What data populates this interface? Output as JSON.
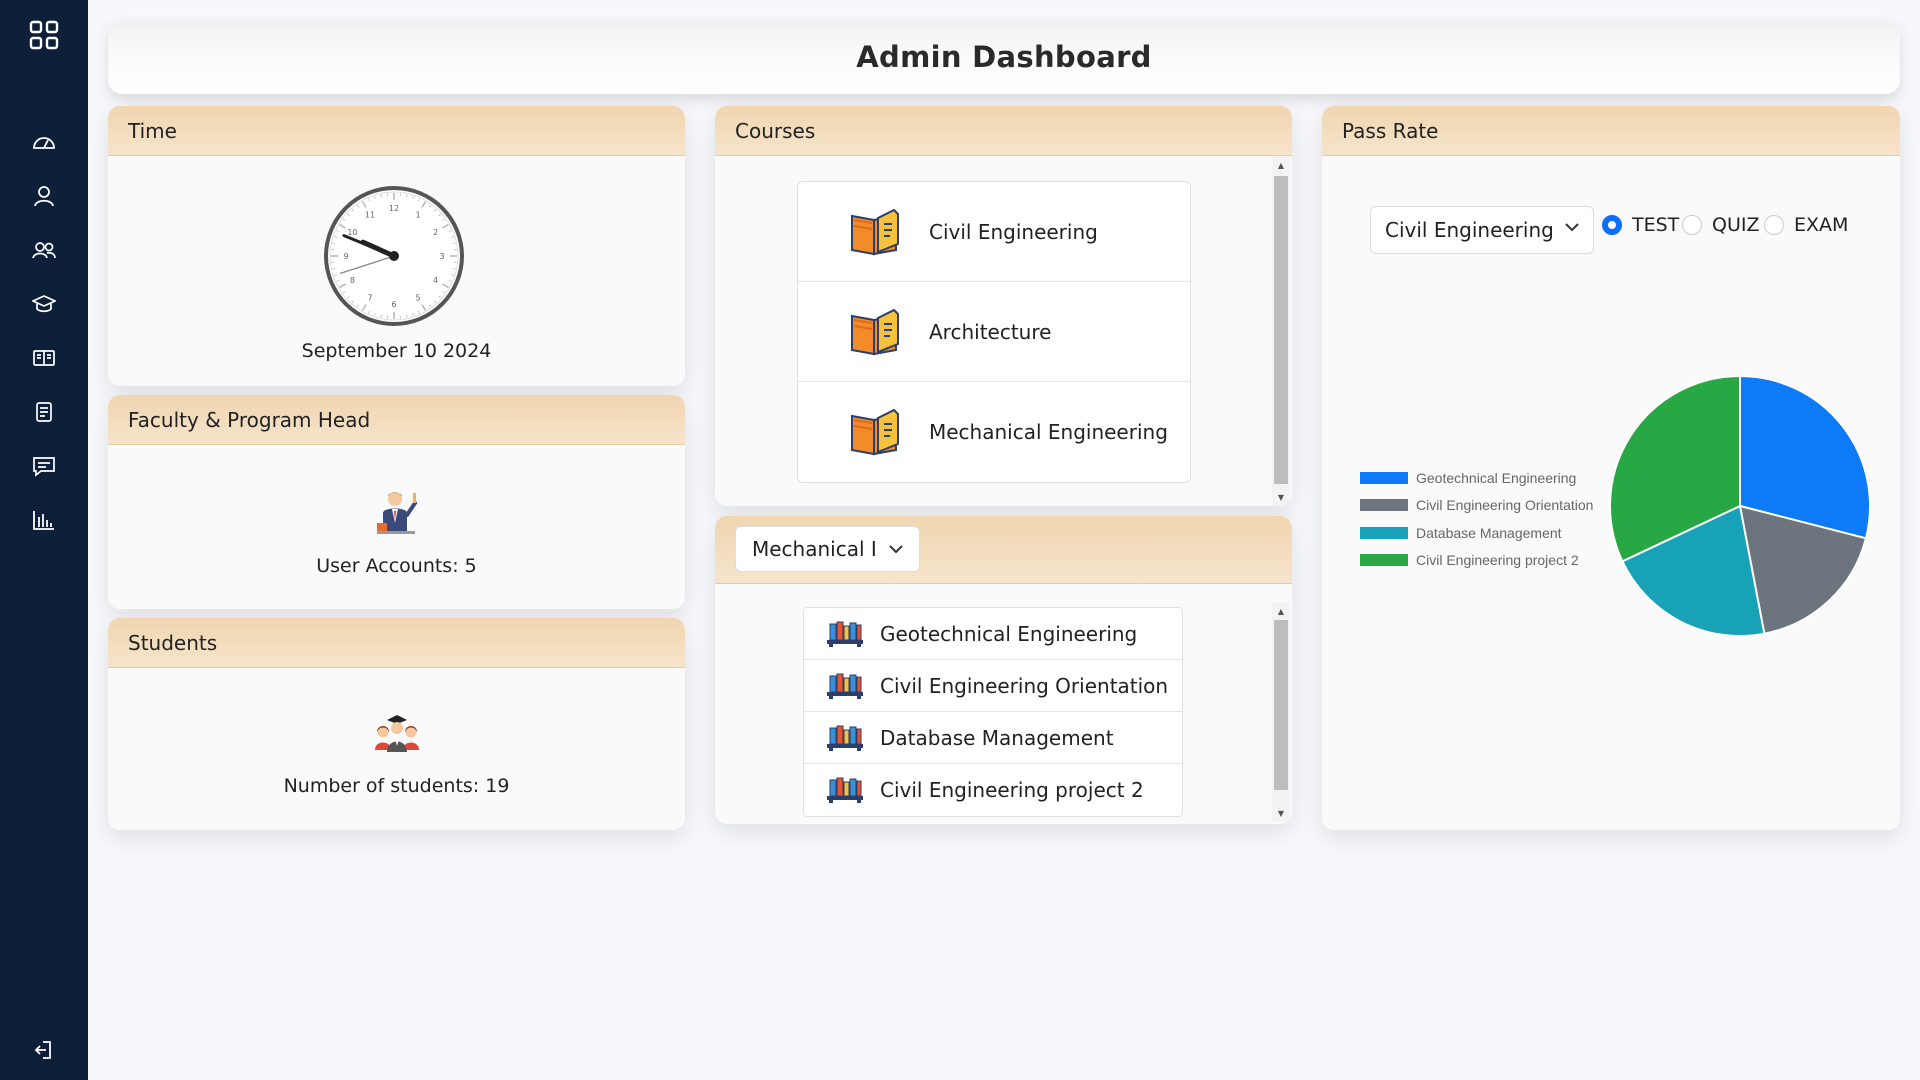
{
  "header": {
    "title": "Admin Dashboard"
  },
  "sidebar": {
    "items": [
      {
        "name": "apps-grid-icon"
      },
      {
        "name": "dashboard-gauge-icon"
      },
      {
        "name": "user-icon"
      },
      {
        "name": "users-icon"
      },
      {
        "name": "graduation-cap-icon"
      },
      {
        "name": "book-open-icon"
      },
      {
        "name": "document-icon"
      },
      {
        "name": "chat-icon"
      },
      {
        "name": "bar-chart-icon"
      },
      {
        "name": "logout-icon"
      }
    ]
  },
  "time": {
    "title": "Time",
    "date": "September 10 2024",
    "clock": {
      "hour": 9,
      "minute": 48,
      "second": 42
    }
  },
  "faculty": {
    "title": "Faculty & Program Head",
    "text": "User Accounts: 5"
  },
  "students": {
    "title": "Students",
    "text": "Number of students: 19"
  },
  "courses": {
    "title": "Courses",
    "items": [
      {
        "label": "Civil Engineering"
      },
      {
        "label": "Architecture"
      },
      {
        "label": "Mechanical Engineering"
      }
    ]
  },
  "subjects": {
    "select_value": "Mechanical I",
    "items": [
      {
        "label": "Geotechnical Engineering"
      },
      {
        "label": "Civil Engineering Orientation"
      },
      {
        "label": "Database Management"
      },
      {
        "label": "Civil Engineering project 2"
      }
    ]
  },
  "pass_rate": {
    "title": "Pass Rate",
    "select_value": "Civil Engineering",
    "options": [
      {
        "label": "TEST",
        "checked": true
      },
      {
        "label": "QUIZ",
        "checked": false
      },
      {
        "label": "EXAM",
        "checked": false
      }
    ]
  },
  "chart_data": {
    "type": "pie",
    "legend_position": "left",
    "series": [
      {
        "name": "Geotechnical Engineering",
        "value": 29,
        "color": "#0d7bf7"
      },
      {
        "name": "Civil Engineering Orientation",
        "value": 18,
        "color": "#6c757d"
      },
      {
        "name": "Database Management",
        "value": 21,
        "color": "#17a2b8"
      },
      {
        "name": "Civil Engineering project 2",
        "value": 32,
        "color": "#28a745"
      }
    ]
  }
}
